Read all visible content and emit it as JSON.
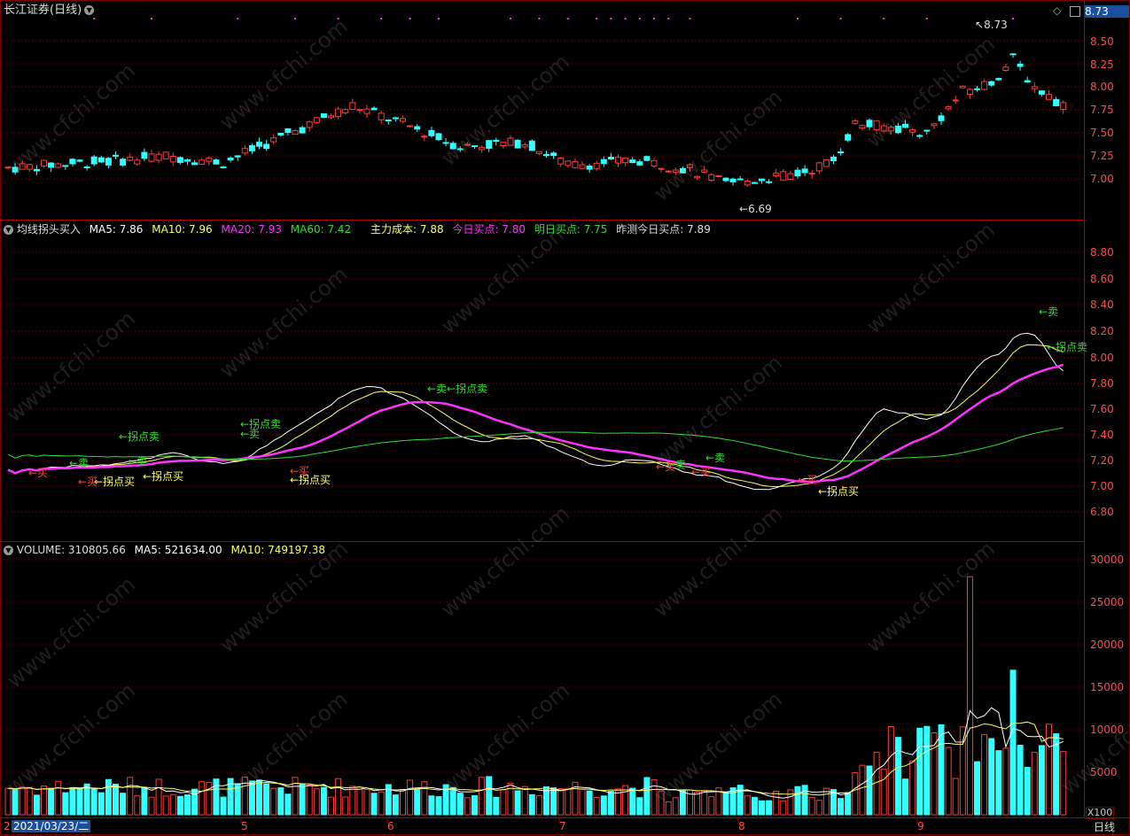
{
  "header": {
    "title": "长江证券(日线)",
    "price_badge": "8.73"
  },
  "price_panel": {
    "high_label": "8.73",
    "low_label": "6.69",
    "axis": [
      "8.50",
      "8.25",
      "8.00",
      "7.75",
      "7.50",
      "7.25",
      "7.00"
    ]
  },
  "indicator_panel": {
    "name": "均线拐头买入",
    "ma5": "MA5: 7.86",
    "ma10": "MA10: 7.96",
    "ma20": "MA20: 7.93",
    "ma60": "MA60: 7.42",
    "main_cost": "主力成本: 7.88",
    "today_buy": "今日买点: 7.80",
    "tomorrow_buy": "明日买点: 7.75",
    "predict_today_buy": "昨测今日买点: 7.89",
    "axis": [
      "8.80",
      "8.60",
      "8.40",
      "8.20",
      "8.00",
      "7.80",
      "7.60",
      "7.40",
      "7.20",
      "7.00",
      "6.80"
    ],
    "annotations": [
      {
        "text": "←卖",
        "color": "#33dd33"
      },
      {
        "text": "←拐点买",
        "color": "#ffff66"
      },
      {
        "text": "←拐点卖",
        "color": "#33dd33"
      },
      {
        "text": "←买",
        "color": "#ff4444"
      },
      {
        "text": "←卖",
        "color": "#33dd33"
      },
      {
        "text": "←拐点买",
        "color": "#ffff66"
      },
      {
        "text": "←拐点卖",
        "color": "#33dd33"
      },
      {
        "text": "←卖",
        "color": "#33dd33"
      },
      {
        "text": "←买",
        "color": "#ff4444"
      },
      {
        "text": "←拐点买",
        "color": "#ffff66"
      },
      {
        "text": "←卖←拐点卖",
        "color": "#33dd33"
      },
      {
        "text": "←卖",
        "color": "#33dd33"
      },
      {
        "text": "←卖",
        "color": "#33dd33"
      },
      {
        "text": "←买",
        "color": "#ff4444"
      },
      {
        "text": "←拐点买",
        "color": "#ffff66"
      },
      {
        "text": "←卖",
        "color": "#33dd33"
      },
      {
        "text": "←拐点卖",
        "color": "#33dd33"
      },
      {
        "text": "←买",
        "color": "#ff4444"
      },
      {
        "text": "←买",
        "color": "#ff4444"
      },
      {
        "text": "←买",
        "color": "#ff4444"
      }
    ]
  },
  "volume_panel": {
    "volume": "VOLUME: 310805.66",
    "ma5": "MA5: 521634.00",
    "ma10": "MA10: 749197.38",
    "axis": [
      "30000",
      "25000",
      "20000",
      "15000",
      "10000",
      "5000"
    ],
    "unit": "X100"
  },
  "x_axis": {
    "first_date": "2021/03/23/二",
    "months": [
      "5",
      "6",
      "7",
      "8",
      "9"
    ],
    "period_button": "日线",
    "left_mark": "2"
  },
  "watermark": "www.cfchi.com",
  "colors": {
    "up": "#ff3b3b",
    "down": "#33ffff",
    "grid": "#7a0000",
    "ma5": "#ffffff",
    "ma10": "#ffff66",
    "ma20": "#ff33ff",
    "ma60": "#33dd33"
  }
}
